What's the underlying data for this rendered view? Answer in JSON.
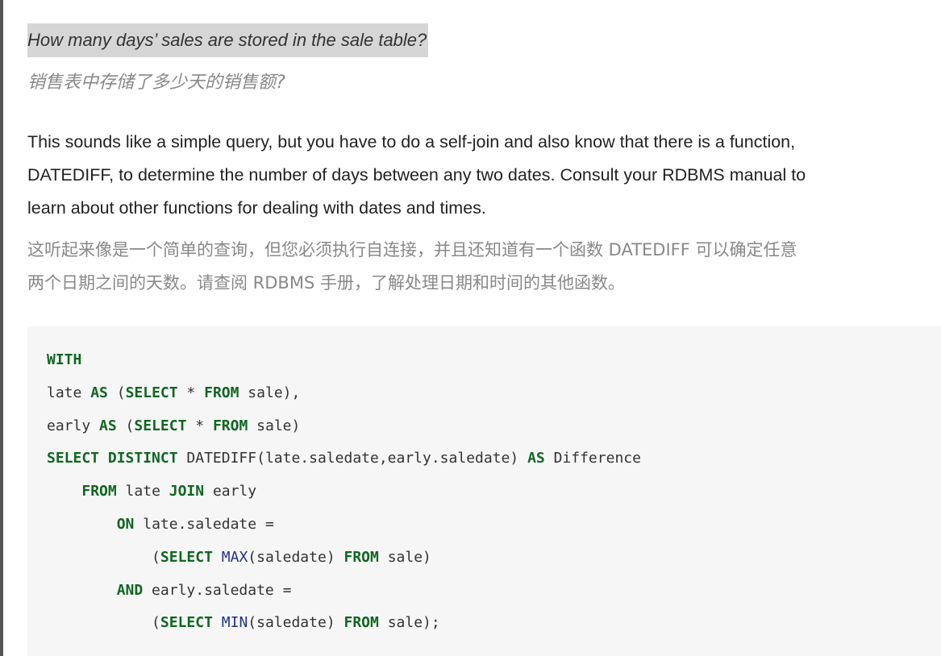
{
  "question": {
    "en": "How many days’ sales are stored in the sale table?",
    "zh": "销售表中存储了多少天的销售额?"
  },
  "paragraph": {
    "en_lines": [
      "This sounds like a simple query, but you have to do a self-join and also know that there is a function,",
      "DATEDIFF, to determine the number of days between any two dates. Consult your RDBMS manual to",
      "learn about other functions for dealing with dates and times."
    ],
    "zh_lines": [
      "这听起来像是一个简单的查询，但您必须执行自连接，并且还知道有一个函数 DATEDIFF 可以确定任意",
      "两个日期之间的天数。请查阅 RDBMS 手册，了解处理日期和时间的其他函数。"
    ]
  },
  "code": {
    "language": "sql",
    "lines": [
      [
        {
          "t": "WITH",
          "c": "kw"
        }
      ],
      [
        {
          "t": "late ",
          "c": ""
        },
        {
          "t": "AS",
          "c": "kw"
        },
        {
          "t": " (",
          "c": ""
        },
        {
          "t": "SELECT",
          "c": "kw"
        },
        {
          "t": " * ",
          "c": ""
        },
        {
          "t": "FROM",
          "c": "kw"
        },
        {
          "t": " sale),",
          "c": ""
        }
      ],
      [
        {
          "t": "early ",
          "c": ""
        },
        {
          "t": "AS",
          "c": "kw"
        },
        {
          "t": " (",
          "c": ""
        },
        {
          "t": "SELECT",
          "c": "kw"
        },
        {
          "t": " * ",
          "c": ""
        },
        {
          "t": "FROM",
          "c": "kw"
        },
        {
          "t": " sale)",
          "c": ""
        }
      ],
      [
        {
          "t": "SELECT",
          "c": "kw"
        },
        {
          "t": " ",
          "c": ""
        },
        {
          "t": "DISTINCT",
          "c": "kw"
        },
        {
          "t": " DATEDIFF(late.saledate,early.saledate) ",
          "c": ""
        },
        {
          "t": "AS",
          "c": "kw"
        },
        {
          "t": " Difference",
          "c": ""
        }
      ],
      [
        {
          "t": "    ",
          "c": ""
        },
        {
          "t": "FROM",
          "c": "kw"
        },
        {
          "t": " late ",
          "c": ""
        },
        {
          "t": "JOIN",
          "c": "kw"
        },
        {
          "t": " early",
          "c": ""
        }
      ],
      [
        {
          "t": "        ",
          "c": ""
        },
        {
          "t": "ON",
          "c": "kw"
        },
        {
          "t": " late.saledate =",
          "c": ""
        }
      ],
      [
        {
          "t": "            (",
          "c": ""
        },
        {
          "t": "SELECT",
          "c": "kw"
        },
        {
          "t": " ",
          "c": ""
        },
        {
          "t": "MAX",
          "c": "fn"
        },
        {
          "t": "(saledate) ",
          "c": ""
        },
        {
          "t": "FROM",
          "c": "kw"
        },
        {
          "t": " sale)",
          "c": ""
        }
      ],
      [
        {
          "t": "        ",
          "c": ""
        },
        {
          "t": "AND",
          "c": "kw"
        },
        {
          "t": " early.saledate =",
          "c": ""
        }
      ],
      [
        {
          "t": "            (",
          "c": ""
        },
        {
          "t": "SELECT",
          "c": "kw"
        },
        {
          "t": " ",
          "c": ""
        },
        {
          "t": "MIN",
          "c": "fn"
        },
        {
          "t": "(saledate) ",
          "c": ""
        },
        {
          "t": "FROM",
          "c": "kw"
        },
        {
          "t": " sale);",
          "c": ""
        }
      ]
    ]
  },
  "colors": {
    "keyword": "#116622",
    "function": "#223388",
    "highlight": "#d6d6d6",
    "code_background": "#f6f6f6",
    "translation_text": "#888888"
  }
}
